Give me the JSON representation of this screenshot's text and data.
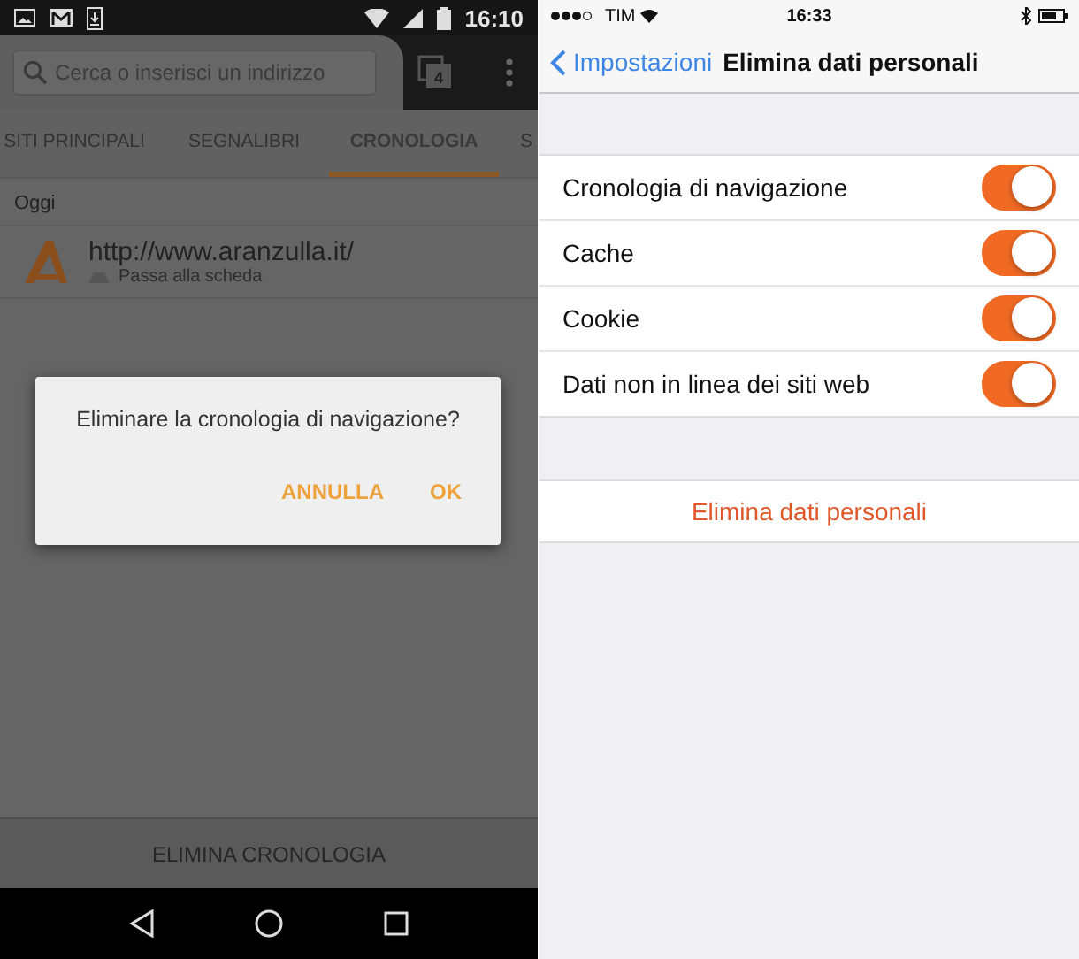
{
  "left_screen": {
    "status_bar": {
      "time": "16:10"
    },
    "search": {
      "placeholder": "Cerca o inserisci un indirizzo"
    },
    "tab_count": "4",
    "tabs": [
      {
        "label": "SITI PRINCIPALI",
        "selected": false
      },
      {
        "label": "SEGNALIBRI",
        "selected": false
      },
      {
        "label": "CRONOLOGIA",
        "selected": true
      },
      {
        "label": "S",
        "selected": false
      }
    ],
    "section_header": "Oggi",
    "history": [
      {
        "url": "http://www.aranzulla.it/",
        "subtitle": "Passa alla scheda"
      }
    ],
    "dialog": {
      "message": "Eliminare la cronologia di navigazione?",
      "buttons": [
        "ANNULLA",
        "OK"
      ]
    },
    "bottom_button": "ELIMINA CRONOLOGIA"
  },
  "right_screen": {
    "status_bar": {
      "carrier": "TIM",
      "time": "16:33"
    },
    "back": "Impostazioni",
    "title": "Elimina dati personali",
    "options": [
      {
        "label": "Cronologia di navigazione",
        "on": true
      },
      {
        "label": "Cache",
        "on": true
      },
      {
        "label": "Cookie",
        "on": true
      },
      {
        "label": "Dati non in linea dei siti web",
        "on": true
      }
    ],
    "action_button": "Elimina dati personali"
  }
}
